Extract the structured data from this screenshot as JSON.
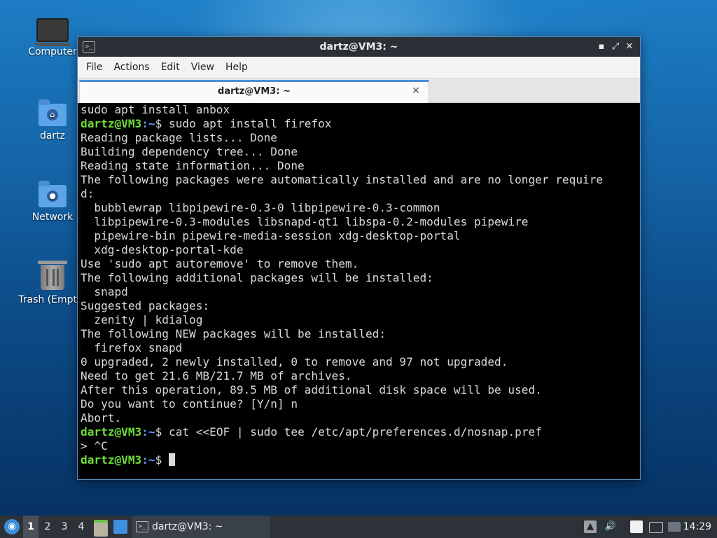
{
  "desktop": {
    "icons": [
      {
        "label": "Computer"
      },
      {
        "label": "dartz"
      },
      {
        "label": "Network"
      },
      {
        "label": "Trash (Empty)"
      }
    ]
  },
  "window": {
    "title": "dartz@VM3: ~",
    "controls": {
      "minimize": "▪",
      "maximize": "⤢",
      "close": "✕"
    },
    "menu": [
      "File",
      "Actions",
      "Edit",
      "View",
      "Help"
    ],
    "tab": {
      "label": "dartz@VM3: ~",
      "close": "✕"
    }
  },
  "terminal": {
    "prompt_user": "dartz@VM3",
    "prompt_path": ":~",
    "prompt_symbol": "$ ",
    "lines": [
      "sudo apt install anbox",
      "sudo apt install firefox",
      "Reading package lists... Done",
      "Building dependency tree... Done",
      "Reading state information... Done",
      "The following packages were automatically installed and are no longer require",
      "d:",
      "  bubblewrap libpipewire-0.3-0 libpipewire-0.3-common",
      "  libpipewire-0.3-modules libsnapd-qt1 libspa-0.2-modules pipewire",
      "  pipewire-bin pipewire-media-session xdg-desktop-portal",
      "  xdg-desktop-portal-kde",
      "Use 'sudo apt autoremove' to remove them.",
      "The following additional packages will be installed:",
      "  snapd",
      "Suggested packages:",
      "  zenity | kdialog",
      "The following NEW packages will be installed:",
      "  firefox snapd",
      "0 upgraded, 2 newly installed, 0 to remove and 97 not upgraded.",
      "Need to get 21.6 MB/21.7 MB of archives.",
      "After this operation, 89.5 MB of additional disk space will be used.",
      "Do you want to continue? [Y/n] n",
      "Abort.",
      "cat <<EOF | sudo tee /etc/apt/preferences.d/nosnap.pref",
      "> ^C",
      ""
    ]
  },
  "taskbar": {
    "start_icon": "start-menu-icon",
    "workspaces": [
      "1",
      "2",
      "3",
      "4"
    ],
    "task_label": "dartz@VM3: ~",
    "clock": "14:29"
  }
}
